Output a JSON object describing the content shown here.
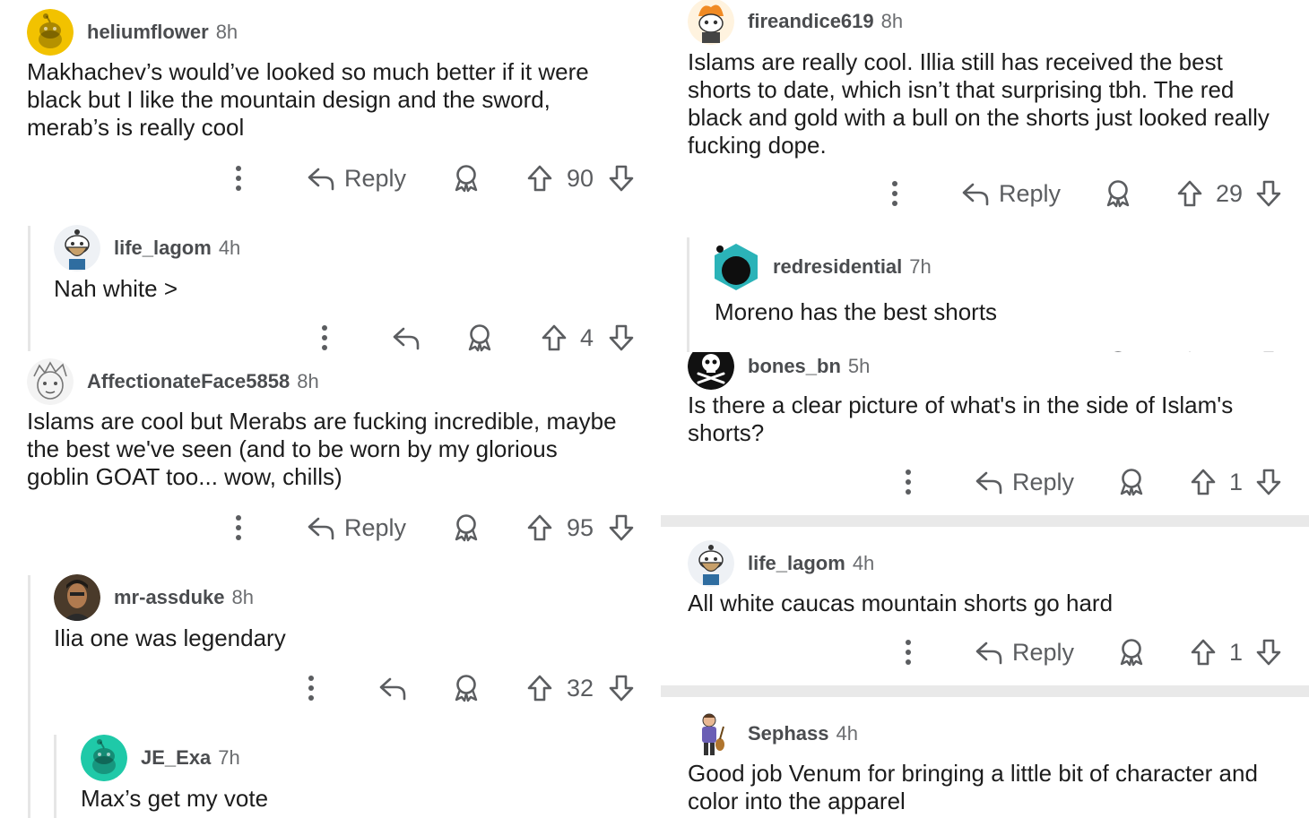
{
  "left": {
    "c1": {
      "user": "heliumflower",
      "age": "8h",
      "avatar": "snoo-yellow-icon",
      "lines": [
        "Makhachev’s would’ve looked so much better if it were",
        "black but I like the mountain design and the sword,",
        "merab’s is really cool"
      ],
      "reply_label": "Reply",
      "score": "90"
    },
    "c2": {
      "user": "life_lagom",
      "age": "4h",
      "avatar": "bearded-snoo-icon",
      "lines": [
        "Nah white >"
      ],
      "score": "4"
    },
    "c3": {
      "user": "AffectionateFace5858",
      "age": "8h",
      "avatar": "sketch-face-icon",
      "lines": [
        "Islams are cool but Merabs are fucking incredible, maybe",
        "the best we've seen (and to be worn by my glorious",
        "goblin GOAT too... wow, chills)"
      ],
      "reply_label": "Reply",
      "score": "95"
    },
    "c4": {
      "user": "mr-assduke",
      "age": "8h",
      "avatar": "photo-man-icon",
      "lines": [
        "Ilia one was legendary"
      ],
      "score": "32"
    },
    "c5": {
      "user": "JE_Exa",
      "age": "7h",
      "avatar": "snoo-teal-icon",
      "lines": [
        "Max’s get my vote"
      ]
    }
  },
  "right": {
    "c1": {
      "user": "fireandice619",
      "age": "8h",
      "avatar": "fire-snoo-icon",
      "lines": [
        "Islams are really cool. Illia still has received the best",
        "shorts to date, which isn’t that surprising tbh. The red",
        "black and gold with a bull on the shorts just looked really",
        "fucking dope."
      ],
      "reply_label": "Reply",
      "score": "29"
    },
    "c2": {
      "user": "redresidential",
      "age": "7h",
      "avatar": "dark-snoo-icon",
      "lines": [
        "Moreno has the best shorts"
      ]
    },
    "c3": {
      "user": "bones_bn",
      "age": "5h",
      "avatar": "skull-icon",
      "lines": [
        "Is there a clear picture of what's in the side of Islam's",
        "shorts?"
      ],
      "reply_label": "Reply",
      "score": "1"
    },
    "c4": {
      "user": "life_lagom",
      "age": "4h",
      "avatar": "bearded-snoo-icon",
      "lines": [
        "All white caucas mountain shorts go hard"
      ],
      "reply_label": "Reply",
      "score": "1"
    },
    "c5": {
      "user": "Sephass",
      "age": "4h",
      "avatar": "guitar-person-icon",
      "lines": [
        "Good job Venum for bringing a little bit of character and",
        "color into the apparel"
      ]
    }
  }
}
